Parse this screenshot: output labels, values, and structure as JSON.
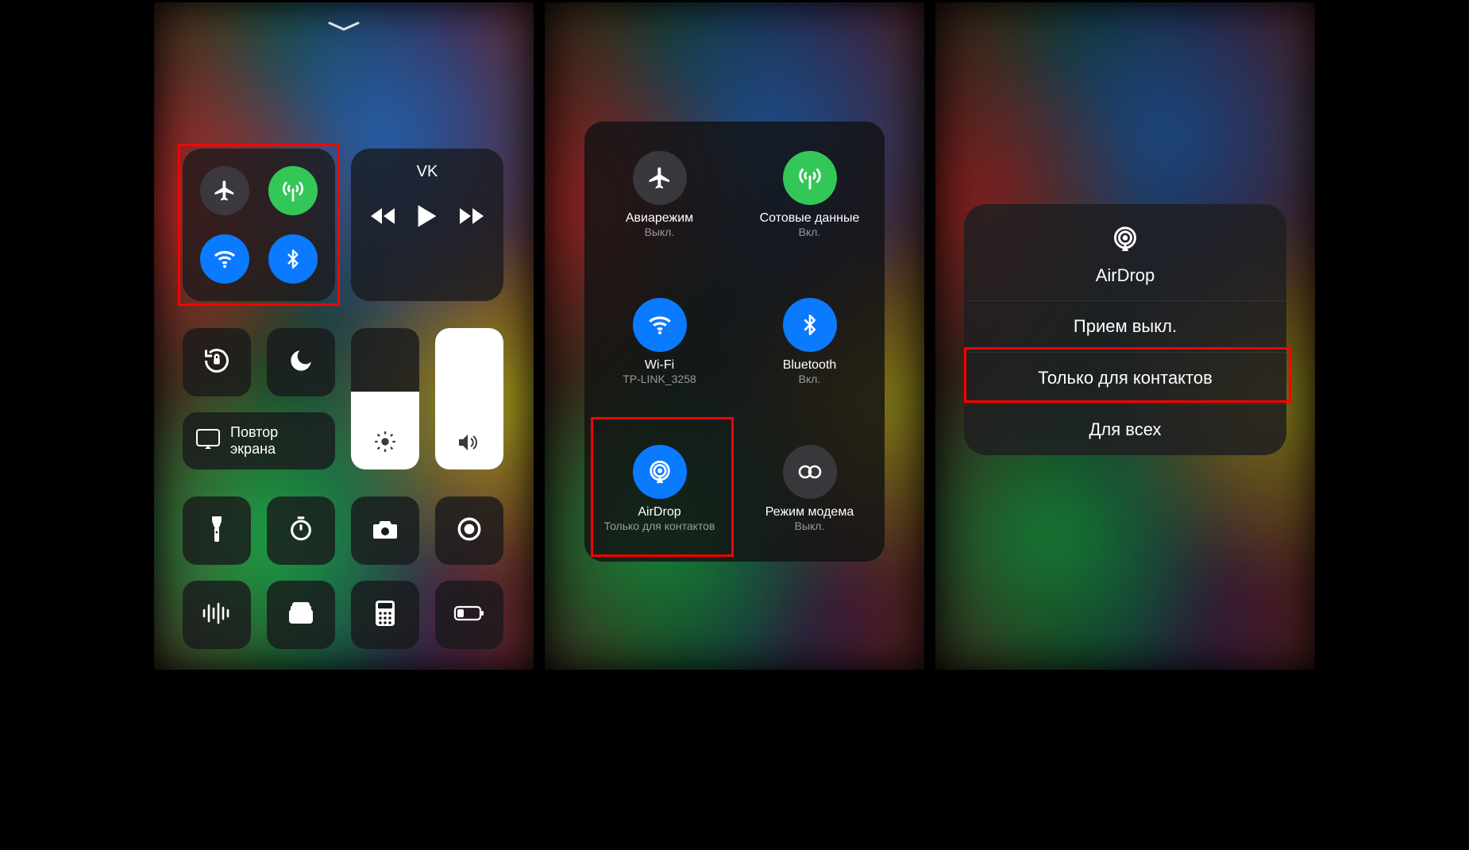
{
  "panel1": {
    "media_source": "VK",
    "screen_mirror": "Повтор\nэкрана"
  },
  "panel2": {
    "airplane": {
      "label": "Авиарежим",
      "status": "Выкл."
    },
    "cellular": {
      "label": "Сотовые данные",
      "status": "Вкл."
    },
    "wifi": {
      "label": "Wi-Fi",
      "status": "TP-LINK_3258"
    },
    "bluetooth": {
      "label": "Bluetooth",
      "status": "Вкл."
    },
    "airdrop": {
      "label": "AirDrop",
      "status": "Только для контактов"
    },
    "hotspot": {
      "label": "Режим модема",
      "status": "Выкл."
    }
  },
  "panel3": {
    "title": "AirDrop",
    "options": [
      "Прием выкл.",
      "Только для контактов",
      "Для всех"
    ]
  }
}
